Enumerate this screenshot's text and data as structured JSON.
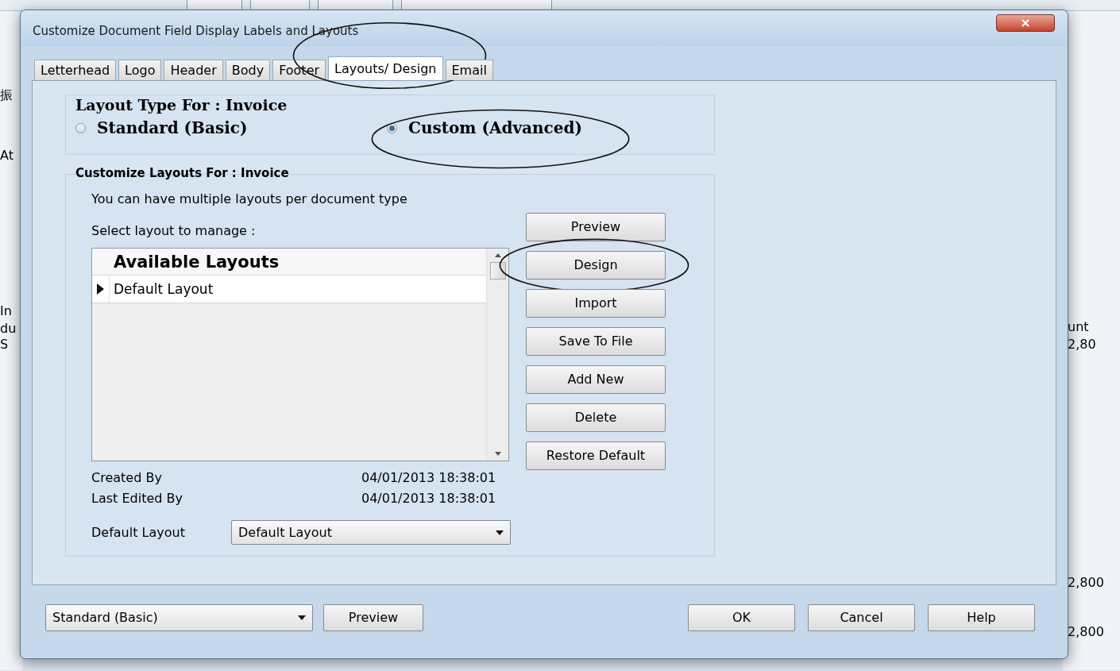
{
  "background": {
    "left_labels": [
      "振",
      "At",
      "In",
      "du",
      "S"
    ],
    "right_labels": [
      "unt",
      "2,80",
      "2,800",
      "2,800"
    ]
  },
  "window": {
    "title": "Customize Document Field Display Labels and Layouts"
  },
  "tabs": [
    {
      "label": "Letterhead",
      "selected": false,
      "circled": false
    },
    {
      "label": "Logo",
      "selected": false,
      "circled": false
    },
    {
      "label": "Header",
      "selected": false,
      "circled": false
    },
    {
      "label": "Body",
      "selected": false,
      "circled": false
    },
    {
      "label": "Footer",
      "selected": false,
      "circled": false
    },
    {
      "label": "Layouts/ Design",
      "selected": true,
      "circled": true
    },
    {
      "label": "Email",
      "selected": false,
      "circled": false
    }
  ],
  "layout_type": {
    "label": "Layout Type For : Invoice",
    "options": [
      {
        "label": "Standard (Basic)",
        "selected": false,
        "circled": false
      },
      {
        "label": "Custom (Advanced)",
        "selected": true,
        "circled": true
      }
    ]
  },
  "customize": {
    "label": "Customize Layouts For : Invoice",
    "note": "You can have multiple layouts per document type",
    "select_label": "Select layout to manage :",
    "list": {
      "header": "Available Layouts",
      "rows": [
        {
          "name": "Default Layout",
          "selected": true
        }
      ]
    },
    "buttons": [
      {
        "label": "Preview",
        "circled": false
      },
      {
        "label": "Design",
        "circled": true
      },
      {
        "label": "Import",
        "circled": false
      },
      {
        "label": "Save To File",
        "circled": false
      },
      {
        "label": "Add New",
        "circled": false
      },
      {
        "label": "Delete",
        "circled": false
      },
      {
        "label": "Restore Default",
        "circled": false
      }
    ],
    "info": [
      {
        "label": "Created By",
        "value": "04/01/2013 18:38:01"
      },
      {
        "label": "Last Edited By",
        "value": "04/01/2013 18:38:01"
      }
    ],
    "default_layout": {
      "label": "Default Layout",
      "value": "Default Layout"
    }
  },
  "footer": {
    "mode": "Standard (Basic)",
    "preview": "Preview",
    "buttons": [
      "OK",
      "Cancel",
      "Help"
    ]
  }
}
